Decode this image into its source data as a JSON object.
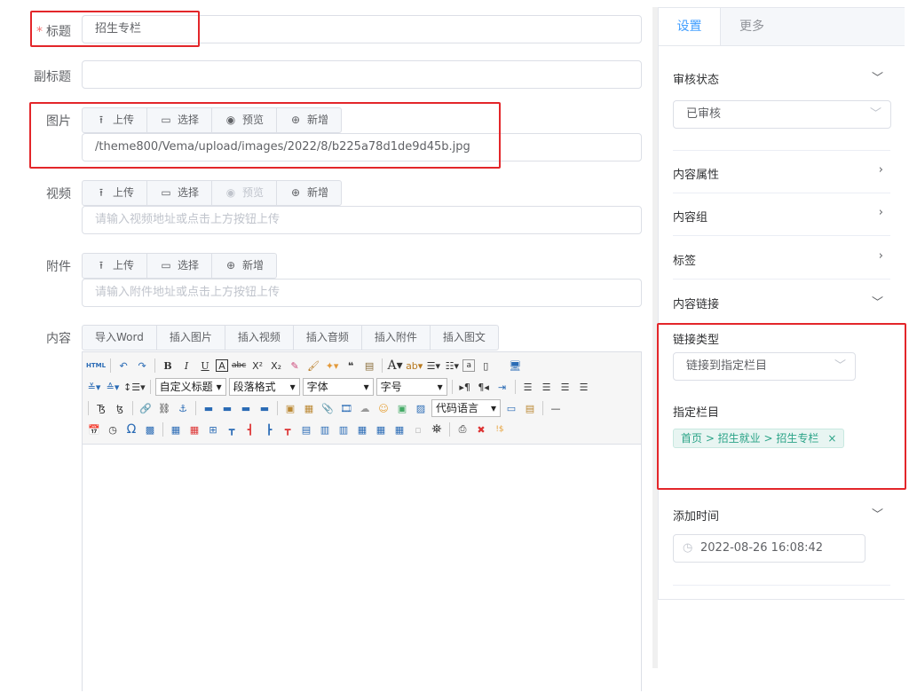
{
  "form": {
    "title_label": "标题",
    "title_value": "招生专栏",
    "subtitle_label": "副标题",
    "subtitle_value": "",
    "image_label": "图片",
    "image_value": "/theme800/Vema/upload/images/2022/8/b225a78d1de9d45b.jpg",
    "video_label": "视频",
    "video_placeholder": "请输入视频地址或点击上方按钮上传",
    "attach_label": "附件",
    "attach_placeholder": "请输入附件地址或点击上方按钮上传",
    "content_label": "内容"
  },
  "upload_buttons": {
    "upload": "上传",
    "select": "选择",
    "preview": "预览",
    "add": "新增"
  },
  "content_buttons": [
    "导入Word",
    "插入图片",
    "插入视频",
    "插入音频",
    "插入附件",
    "插入图文"
  ],
  "editor": {
    "html_btn": "HTML",
    "custom_title": "自定义标题",
    "para_format": "段落格式",
    "font": "字体",
    "font_size": "字号",
    "code_lang": "代码语言"
  },
  "sidebar": {
    "tab_settings": "设置",
    "tab_more": "更多",
    "review_status_label": "审核状态",
    "review_status_value": "已审核",
    "content_props": "内容属性",
    "content_group": "内容组",
    "tags": "标签",
    "content_link": "内容链接",
    "link_type_label": "链接类型",
    "link_type_value": "链接到指定栏目",
    "target_column_label": "指定栏目",
    "target_column_tag": "首页 > 招生就业 > 招生专栏",
    "add_time_label": "添加时间",
    "add_time_value": "2022-08-26 16:08:42"
  }
}
